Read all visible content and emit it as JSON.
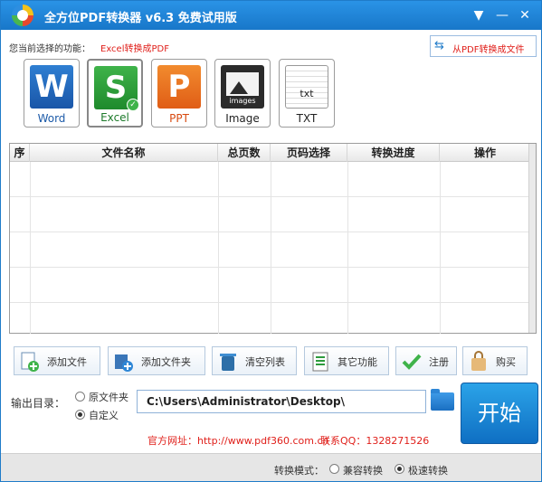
{
  "window": {
    "title": "全方位PDF转换器 v6.3 免费试用版",
    "dropdown_glyph": "▼",
    "minimize_glyph": "—",
    "close_glyph": "✕"
  },
  "current_function": {
    "label": "您当前选择的功能：",
    "value": "Excel转换成PDF"
  },
  "from_pdf_button": {
    "label": "从PDF转换成文件",
    "icon": "swap-arrows-icon"
  },
  "formats": [
    {
      "label": "Word",
      "glyph": "W",
      "icon": "word-icon"
    },
    {
      "label": "Excel",
      "glyph": "S",
      "icon": "excel-icon",
      "selected": true
    },
    {
      "label": "PPT",
      "glyph": "P",
      "icon": "ppt-icon"
    },
    {
      "label": "Image",
      "caption": "images",
      "icon": "image-icon"
    },
    {
      "label": "TXT",
      "caption": "txt",
      "icon": "txt-icon"
    }
  ],
  "table": {
    "columns": [
      "序",
      "文件名称",
      "总页数",
      "页码选择",
      "转换进度",
      "操作"
    ],
    "rows": []
  },
  "actions": [
    {
      "label": "添加文件",
      "icon": "add-file-icon"
    },
    {
      "label": "添加文件夹",
      "icon": "add-folder-icon"
    },
    {
      "label": "清空列表",
      "icon": "trash-icon"
    },
    {
      "label": "其它功能",
      "icon": "list-icon"
    },
    {
      "label": "注册",
      "icon": "check-icon"
    },
    {
      "label": "购买",
      "icon": "shopping-bag-icon"
    }
  ],
  "output": {
    "label": "输出目录：",
    "option_original": "原文件夹",
    "option_custom": "自定义",
    "selected": "自定义",
    "path": "C:\\Users\\Administrator\\Desktop\\"
  },
  "start_button": "开始",
  "info": {
    "website": "官方网址：http://www.pdf360.com.cn",
    "qq": "联系QQ：1328271526"
  },
  "mode": {
    "label": "转换模式：",
    "option_compat": "兼容转换",
    "option_fast": "极速转换",
    "selected": "极速转换"
  },
  "colors": {
    "title_bar": "#1f7bc9",
    "highlight_text": "#e0201b",
    "start_button": "#1a86d6"
  }
}
